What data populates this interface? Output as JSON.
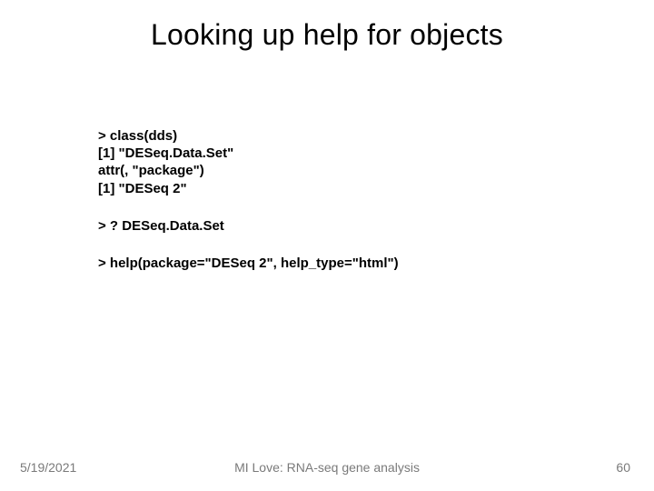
{
  "title": "Looking up help for objects",
  "code": {
    "block1": "> class(dds)\n[1] \"DESeq.Data.Set\"\nattr(, \"package\")\n[1] \"DESeq 2\"",
    "block2": "> ? DESeq.Data.Set",
    "block3": "> help(package=\"DESeq 2\", help_type=\"html\")"
  },
  "footer": {
    "date": "5/19/2021",
    "center": "MI Love: RNA-seq gene analysis",
    "page": "60"
  }
}
